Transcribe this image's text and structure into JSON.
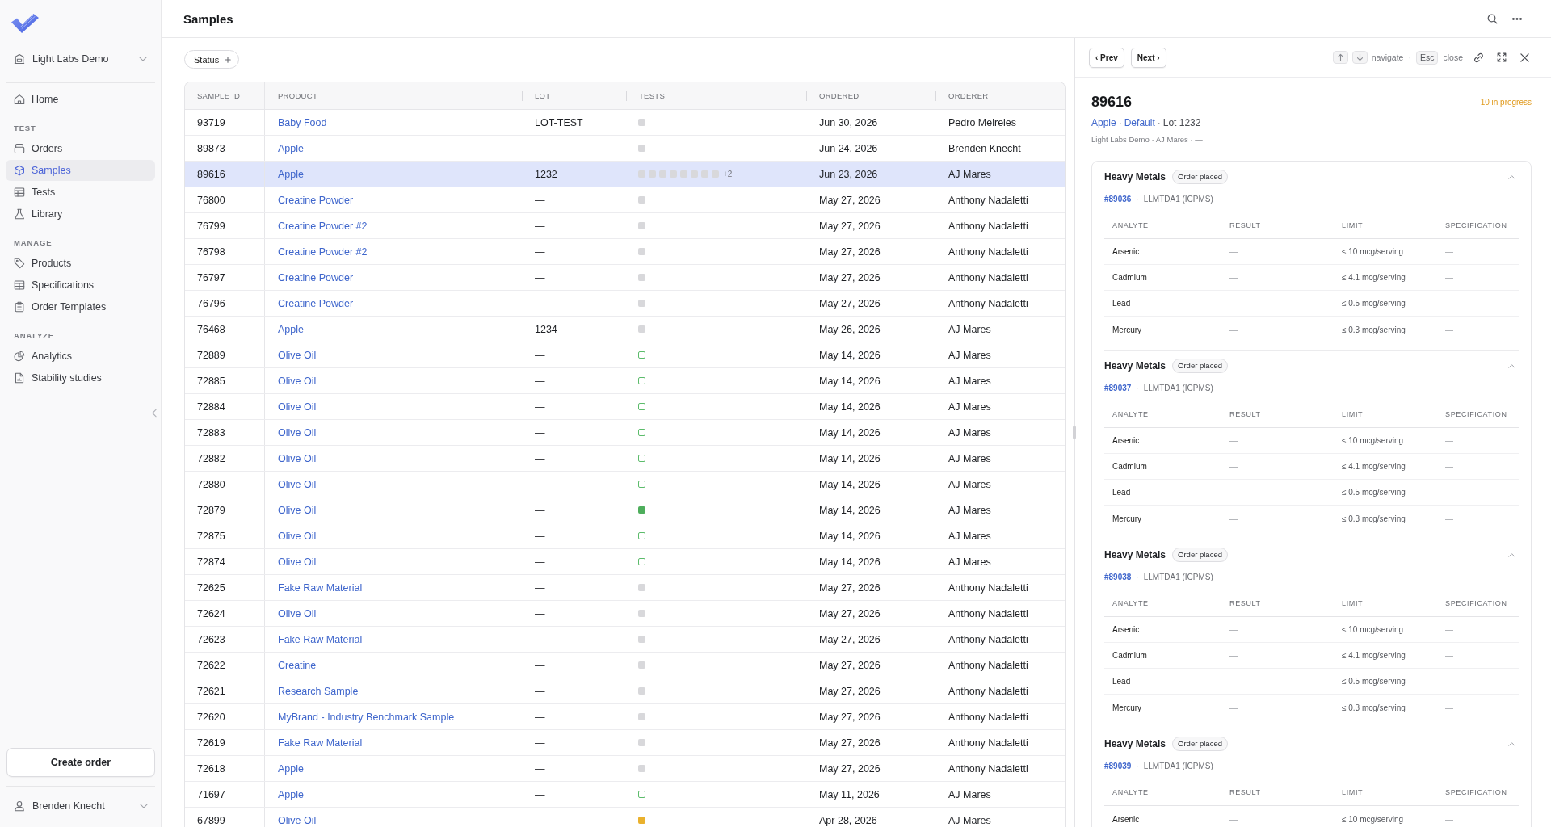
{
  "sidebar": {
    "org": {
      "name": "Light Labs Demo"
    },
    "sections": [
      {
        "items": [
          {
            "label": "Home",
            "selected": false
          }
        ]
      },
      {
        "title": "TEST",
        "items": [
          {
            "label": "Orders",
            "selected": false
          },
          {
            "label": "Samples",
            "selected": true
          },
          {
            "label": "Tests",
            "selected": false
          },
          {
            "label": "Library",
            "selected": false
          }
        ]
      },
      {
        "title": "MANAGE",
        "items": [
          {
            "label": "Products",
            "selected": false
          },
          {
            "label": "Specifications",
            "selected": false
          },
          {
            "label": "Order Templates",
            "selected": false
          }
        ]
      },
      {
        "title": "ANALYZE",
        "items": [
          {
            "label": "Analytics",
            "selected": false
          },
          {
            "label": "Stability studies",
            "selected": false
          }
        ]
      }
    ],
    "create_button": "Create order",
    "user": {
      "name": "Brenden Knecht"
    }
  },
  "header": {
    "title": "Samples"
  },
  "filters": [
    {
      "label": "Status"
    }
  ],
  "table": {
    "columns": [
      "SAMPLE ID",
      "PRODUCT",
      "LOT",
      "TESTS",
      "ORDERED",
      "ORDERER"
    ],
    "rows": [
      {
        "sample_id": "93719",
        "product": "Baby Food",
        "lot": "LOT-TEST",
        "tests": [
          {
            "color": "#d8d8db",
            "filled": true
          }
        ],
        "ordered": "Jun 30, 2026",
        "orderer": "Pedro Meireles",
        "selected": false
      },
      {
        "sample_id": "89873",
        "product": "Apple",
        "lot": "—",
        "tests": [
          {
            "color": "#d8d8db",
            "filled": true
          }
        ],
        "ordered": "Jun 24, 2026",
        "orderer": "Brenden Knecht",
        "selected": false
      },
      {
        "sample_id": "89616",
        "product": "Apple",
        "lot": "1232",
        "tests": [
          {
            "color": "#d8d8db",
            "filled": true
          },
          {
            "color": "#d8d8db",
            "filled": true
          },
          {
            "color": "#d8d8db",
            "filled": true
          },
          {
            "color": "#d8d8db",
            "filled": true
          },
          {
            "color": "#d8d8db",
            "filled": true
          },
          {
            "color": "#d8d8db",
            "filled": true
          },
          {
            "color": "#d8d8db",
            "filled": true
          },
          {
            "color": "#d8d8db",
            "filled": true
          }
        ],
        "more_tests": "+2",
        "ordered": "Jun 23, 2026",
        "orderer": "AJ Mares",
        "selected": true
      },
      {
        "sample_id": "76800",
        "product": "Creatine Powder",
        "lot": "—",
        "tests": [
          {
            "color": "#d8d8db",
            "filled": true
          }
        ],
        "ordered": "May 27, 2026",
        "orderer": "Anthony Nadaletti",
        "selected": false
      },
      {
        "sample_id": "76799",
        "product": "Creatine Powder #2",
        "lot": "—",
        "tests": [
          {
            "color": "#d8d8db",
            "filled": true
          }
        ],
        "ordered": "May 27, 2026",
        "orderer": "Anthony Nadaletti",
        "selected": false
      },
      {
        "sample_id": "76798",
        "product": "Creatine Powder #2",
        "lot": "—",
        "tests": [
          {
            "color": "#d8d8db",
            "filled": true
          }
        ],
        "ordered": "May 27, 2026",
        "orderer": "Anthony Nadaletti",
        "selected": false
      },
      {
        "sample_id": "76797",
        "product": "Creatine Powder",
        "lot": "—",
        "tests": [
          {
            "color": "#d8d8db",
            "filled": true
          }
        ],
        "ordered": "May 27, 2026",
        "orderer": "Anthony Nadaletti",
        "selected": false
      },
      {
        "sample_id": "76796",
        "product": "Creatine Powder",
        "lot": "—",
        "tests": [
          {
            "color": "#d8d8db",
            "filled": true
          }
        ],
        "ordered": "May 27, 2026",
        "orderer": "Anthony Nadaletti",
        "selected": false
      },
      {
        "sample_id": "76468",
        "product": "Apple",
        "lot": "1234",
        "tests": [
          {
            "color": "#d8d8db",
            "filled": true
          }
        ],
        "ordered": "May 26, 2026",
        "orderer": "AJ Mares",
        "selected": false
      },
      {
        "sample_id": "72889",
        "product": "Olive Oil",
        "lot": "—",
        "tests": [
          {
            "color": "#5cbc6b",
            "filled": false
          }
        ],
        "ordered": "May 14, 2026",
        "orderer": "AJ Mares",
        "selected": false
      },
      {
        "sample_id": "72885",
        "product": "Olive Oil",
        "lot": "—",
        "tests": [
          {
            "color": "#5cbc6b",
            "filled": false
          }
        ],
        "ordered": "May 14, 2026",
        "orderer": "AJ Mares",
        "selected": false
      },
      {
        "sample_id": "72884",
        "product": "Olive Oil",
        "lot": "—",
        "tests": [
          {
            "color": "#5cbc6b",
            "filled": false
          }
        ],
        "ordered": "May 14, 2026",
        "orderer": "AJ Mares",
        "selected": false
      },
      {
        "sample_id": "72883",
        "product": "Olive Oil",
        "lot": "—",
        "tests": [
          {
            "color": "#5cbc6b",
            "filled": false
          }
        ],
        "ordered": "May 14, 2026",
        "orderer": "AJ Mares",
        "selected": false
      },
      {
        "sample_id": "72882",
        "product": "Olive Oil",
        "lot": "—",
        "tests": [
          {
            "color": "#5cbc6b",
            "filled": false
          }
        ],
        "ordered": "May 14, 2026",
        "orderer": "AJ Mares",
        "selected": false
      },
      {
        "sample_id": "72880",
        "product": "Olive Oil",
        "lot": "—",
        "tests": [
          {
            "color": "#5cbc6b",
            "filled": false
          }
        ],
        "ordered": "May 14, 2026",
        "orderer": "AJ Mares",
        "selected": false
      },
      {
        "sample_id": "72879",
        "product": "Olive Oil",
        "lot": "—",
        "tests": [
          {
            "color": "#4eae5c",
            "filled": true
          }
        ],
        "ordered": "May 14, 2026",
        "orderer": "AJ Mares",
        "selected": false
      },
      {
        "sample_id": "72875",
        "product": "Olive Oil",
        "lot": "—",
        "tests": [
          {
            "color": "#5cbc6b",
            "filled": false
          }
        ],
        "ordered": "May 14, 2026",
        "orderer": "AJ Mares",
        "selected": false
      },
      {
        "sample_id": "72874",
        "product": "Olive Oil",
        "lot": "—",
        "tests": [
          {
            "color": "#5cbc6b",
            "filled": false
          }
        ],
        "ordered": "May 14, 2026",
        "orderer": "AJ Mares",
        "selected": false
      },
      {
        "sample_id": "72625",
        "product": "Fake Raw Material",
        "lot": "—",
        "tests": [
          {
            "color": "#d8d8db",
            "filled": true
          }
        ],
        "ordered": "May 27, 2026",
        "orderer": "Anthony Nadaletti",
        "selected": false
      },
      {
        "sample_id": "72624",
        "product": "Olive Oil",
        "lot": "—",
        "tests": [
          {
            "color": "#d8d8db",
            "filled": true
          }
        ],
        "ordered": "May 27, 2026",
        "orderer": "Anthony Nadaletti",
        "selected": false
      },
      {
        "sample_id": "72623",
        "product": "Fake Raw Material",
        "lot": "—",
        "tests": [
          {
            "color": "#d8d8db",
            "filled": true
          }
        ],
        "ordered": "May 27, 2026",
        "orderer": "Anthony Nadaletti",
        "selected": false
      },
      {
        "sample_id": "72622",
        "product": "Creatine",
        "lot": "—",
        "tests": [
          {
            "color": "#d8d8db",
            "filled": true
          }
        ],
        "ordered": "May 27, 2026",
        "orderer": "Anthony Nadaletti",
        "selected": false
      },
      {
        "sample_id": "72621",
        "product": "Research Sample",
        "lot": "—",
        "tests": [
          {
            "color": "#d8d8db",
            "filled": true
          }
        ],
        "ordered": "May 27, 2026",
        "orderer": "Anthony Nadaletti",
        "selected": false
      },
      {
        "sample_id": "72620",
        "product": "MyBrand - Industry Benchmark Sample",
        "lot": "—",
        "tests": [
          {
            "color": "#d8d8db",
            "filled": true
          }
        ],
        "ordered": "May 27, 2026",
        "orderer": "Anthony Nadaletti",
        "selected": false
      },
      {
        "sample_id": "72619",
        "product": "Fake Raw Material",
        "lot": "—",
        "tests": [
          {
            "color": "#d8d8db",
            "filled": true
          }
        ],
        "ordered": "May 27, 2026",
        "orderer": "Anthony Nadaletti",
        "selected": false
      },
      {
        "sample_id": "72618",
        "product": "Apple",
        "lot": "—",
        "tests": [
          {
            "color": "#d8d8db",
            "filled": true
          }
        ],
        "ordered": "May 27, 2026",
        "orderer": "Anthony Nadaletti",
        "selected": false
      },
      {
        "sample_id": "71697",
        "product": "Apple",
        "lot": "—",
        "tests": [
          {
            "color": "#5cbc6b",
            "filled": false
          }
        ],
        "ordered": "May 11, 2026",
        "orderer": "AJ Mares",
        "selected": false
      },
      {
        "sample_id": "67899",
        "product": "Olive Oil",
        "lot": "—",
        "tests": [
          {
            "color": "#eab12d",
            "filled": true
          }
        ],
        "ordered": "Apr 28, 2026",
        "orderer": "AJ Mares",
        "selected": false
      }
    ]
  },
  "detail": {
    "nav_buttons": [
      "‹ Prev",
      "Next ›"
    ],
    "hints": [
      {
        "kind": "label",
        "text": "navigate"
      },
      {
        "kind": "separator",
        "text": "·"
      },
      {
        "kind": "key",
        "text": "Esc"
      },
      {
        "kind": "label",
        "text": "close"
      }
    ],
    "title": "89616",
    "progress": "10 in progress",
    "subtitle": [
      {
        "kind": "link",
        "text": "Apple"
      },
      {
        "kind": "separator",
        "text": "·"
      },
      {
        "kind": "link",
        "text": "Default"
      },
      {
        "kind": "separator",
        "text": "·"
      },
      {
        "kind": "text",
        "text": "Lot 1232"
      }
    ],
    "meta": "Light Labs Demo · AJ Mares · —",
    "tests": [
      {
        "name": "Heavy Metals",
        "status": "Order placed",
        "expanded": true,
        "ref": [
          {
            "kind": "link",
            "text": "#89036"
          },
          {
            "kind": "separator",
            "text": "·"
          },
          {
            "kind": "text",
            "text": "LLMTDA1 (ICPMS)"
          }
        ],
        "columns": [
          "ANALYTE",
          "RESULT",
          "LIMIT",
          "SPECIFICATION"
        ],
        "rows": [
          {
            "analyte": "Arsenic",
            "result": "—",
            "limit": "≤ 10 mcg/serving",
            "specification": "—"
          },
          {
            "analyte": "Cadmium",
            "result": "—",
            "limit": "≤ 4.1 mcg/serving",
            "specification": "—"
          },
          {
            "analyte": "Lead",
            "result": "—",
            "limit": "≤ 0.5 mcg/serving",
            "specification": "—"
          },
          {
            "analyte": "Mercury",
            "result": "—",
            "limit": "≤ 0.3 mcg/serving",
            "specification": "—"
          }
        ]
      },
      {
        "name": "Heavy Metals",
        "status": "Order placed",
        "expanded": true,
        "ref": [
          {
            "kind": "link",
            "text": "#89037"
          },
          {
            "kind": "separator",
            "text": "·"
          },
          {
            "kind": "text",
            "text": "LLMTDA1 (ICPMS)"
          }
        ],
        "columns": [
          "ANALYTE",
          "RESULT",
          "LIMIT",
          "SPECIFICATION"
        ],
        "rows": [
          {
            "analyte": "Arsenic",
            "result": "—",
            "limit": "≤ 10 mcg/serving",
            "specification": "—"
          },
          {
            "analyte": "Cadmium",
            "result": "—",
            "limit": "≤ 4.1 mcg/serving",
            "specification": "—"
          },
          {
            "analyte": "Lead",
            "result": "—",
            "limit": "≤ 0.5 mcg/serving",
            "specification": "—"
          },
          {
            "analyte": "Mercury",
            "result": "—",
            "limit": "≤ 0.3 mcg/serving",
            "specification": "—"
          }
        ]
      },
      {
        "name": "Heavy Metals",
        "status": "Order placed",
        "expanded": true,
        "ref": [
          {
            "kind": "link",
            "text": "#89038"
          },
          {
            "kind": "separator",
            "text": "·"
          },
          {
            "kind": "text",
            "text": "LLMTDA1 (ICPMS)"
          }
        ],
        "columns": [
          "ANALYTE",
          "RESULT",
          "LIMIT",
          "SPECIFICATION"
        ],
        "rows": [
          {
            "analyte": "Arsenic",
            "result": "—",
            "limit": "≤ 10 mcg/serving",
            "specification": "—"
          },
          {
            "analyte": "Cadmium",
            "result": "—",
            "limit": "≤ 4.1 mcg/serving",
            "specification": "—"
          },
          {
            "analyte": "Lead",
            "result": "—",
            "limit": "≤ 0.5 mcg/serving",
            "specification": "—"
          },
          {
            "analyte": "Mercury",
            "result": "—",
            "limit": "≤ 0.3 mcg/serving",
            "specification": "—"
          }
        ]
      },
      {
        "name": "Heavy Metals",
        "status": "Order placed",
        "expanded": true,
        "ref": [
          {
            "kind": "link",
            "text": "#89039"
          },
          {
            "kind": "separator",
            "text": "·"
          },
          {
            "kind": "text",
            "text": "LLMTDA1 (ICPMS)"
          }
        ],
        "columns": [
          "ANALYTE",
          "RESULT",
          "LIMIT",
          "SPECIFICATION"
        ],
        "rows": [
          {
            "analyte": "Arsenic",
            "result": "—",
            "limit": "≤ 10 mcg/serving",
            "specification": "—"
          }
        ]
      }
    ]
  }
}
